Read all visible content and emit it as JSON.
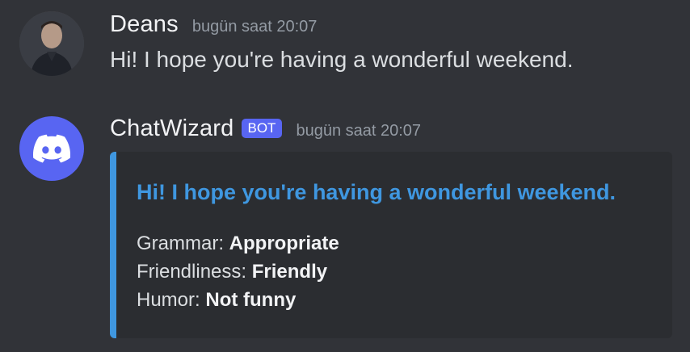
{
  "messages": [
    {
      "author": "Deans",
      "timestamp": "bugün saat 20:07",
      "content": "Hi! I hope you're having a wonderful weekend.",
      "avatar": "user-avatar-photo"
    },
    {
      "author": "ChatWizard",
      "tag": "BOT",
      "timestamp": "bugün saat 20:07",
      "avatar": "discord-logo-icon",
      "embed": {
        "accent_color": "#3f97e0",
        "title": "Hi! I hope you're having a wonderful weekend.",
        "fields": [
          {
            "label": "Grammar:",
            "value": "Appropriate"
          },
          {
            "label": "Friendliness:",
            "value": "Friendly"
          },
          {
            "label": "Humor:",
            "value": "Not funny"
          }
        ]
      }
    }
  ],
  "colors": {
    "background": "#313338",
    "embed_background": "#2b2d31",
    "bot_tag": "#5865f2",
    "timestamp": "#949ba4"
  }
}
